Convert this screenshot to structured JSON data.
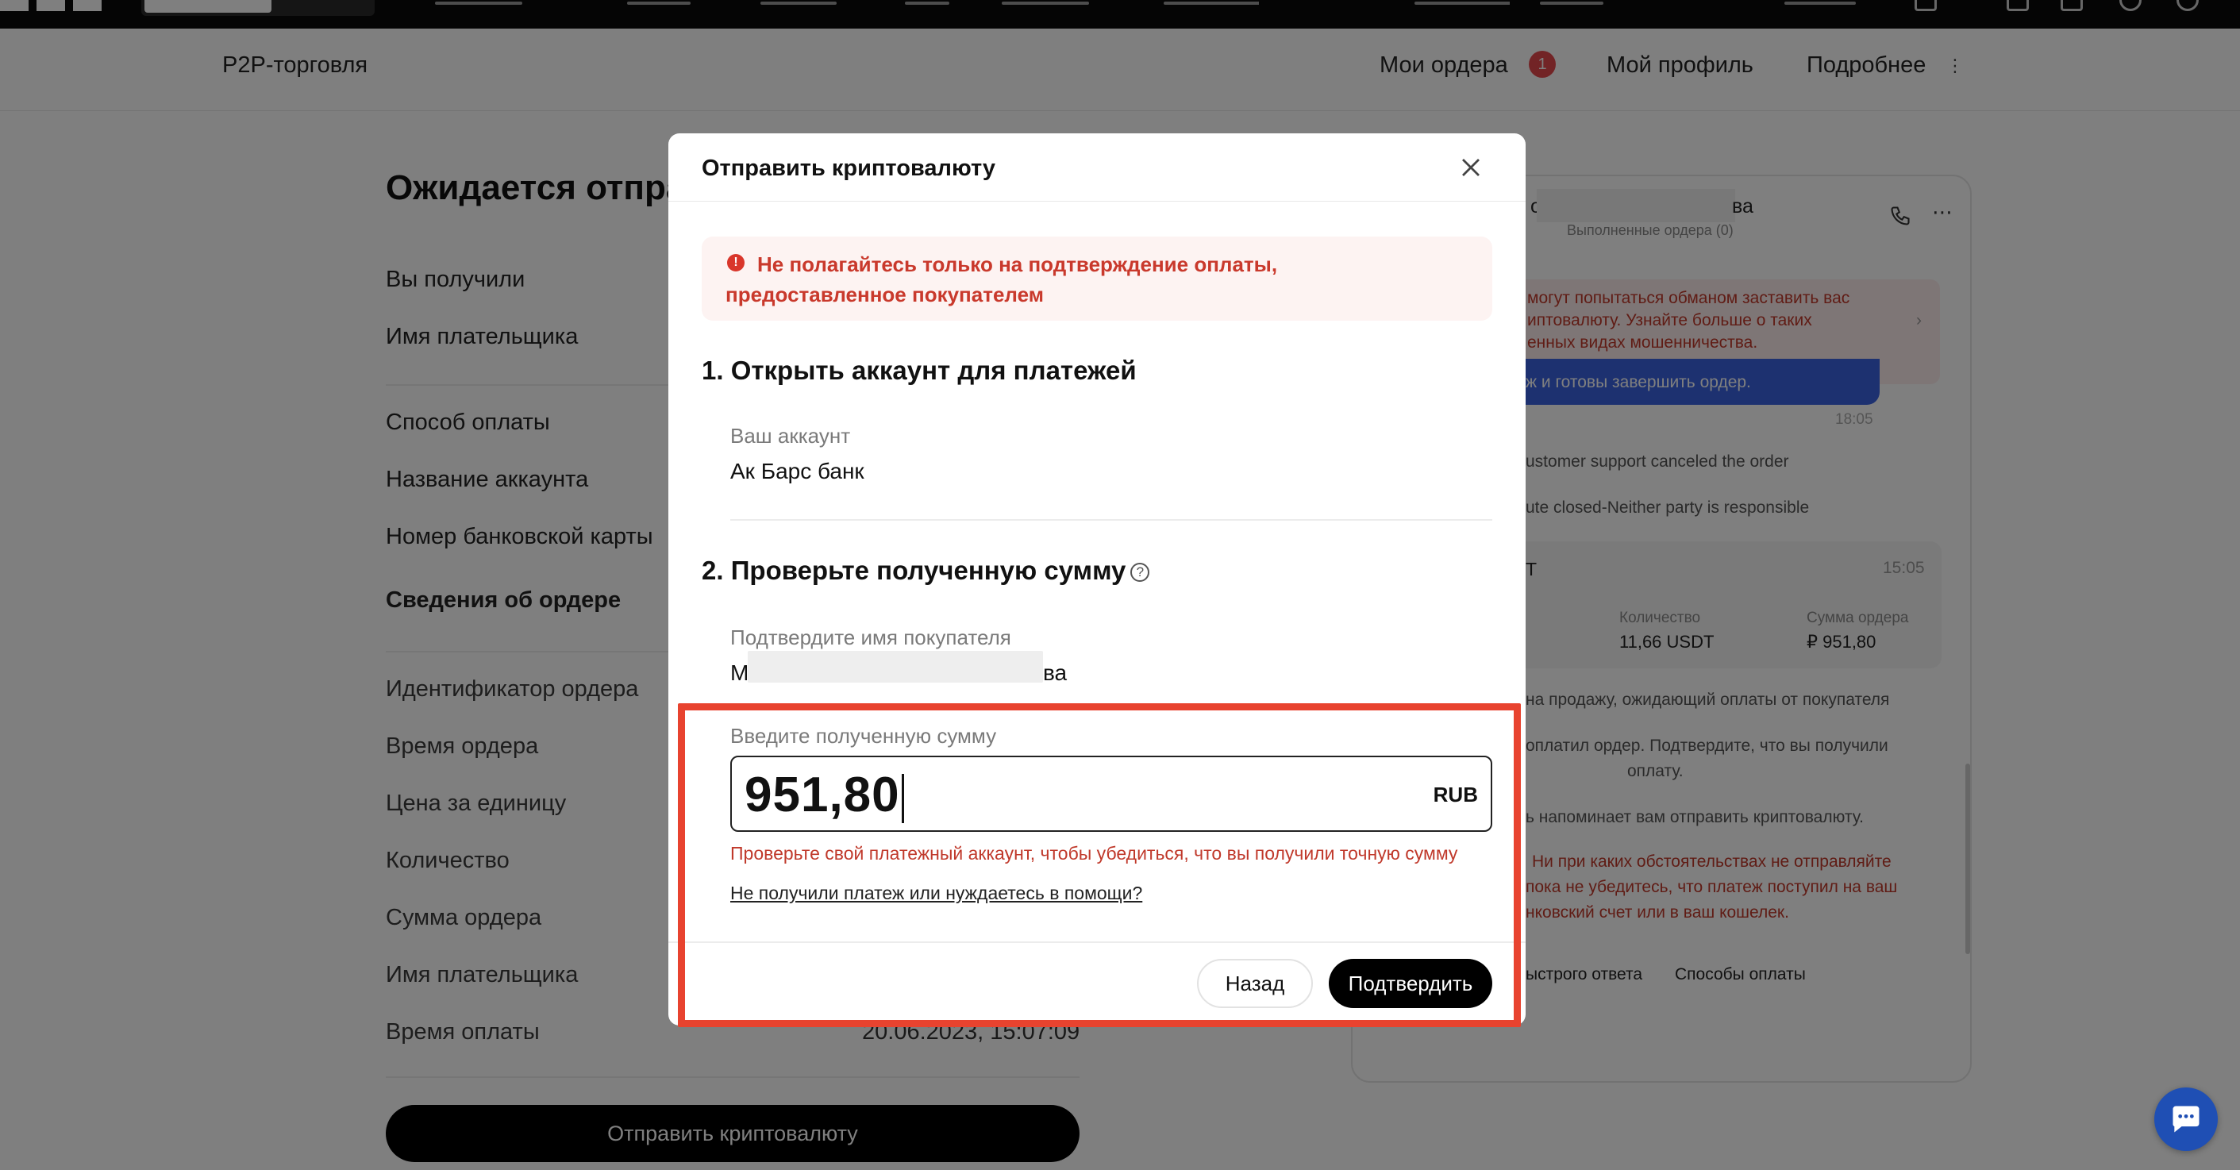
{
  "subheader": {
    "brand": "P2P-торговля",
    "my_orders": "Мои ордера",
    "orders_badge": "1",
    "my_profile": "Мой профиль",
    "more": "Подробнее",
    "more_dots": "⋮"
  },
  "left": {
    "title": "Ожидается отпра",
    "received": "Вы получили",
    "payer_name": "Имя плательщика",
    "payment_method": "Способ оплаты",
    "account_name": "Название аккаунта",
    "card_number": "Номер банковской карты",
    "order_details": "Сведения об ордере",
    "order_id": "Идентификатор ордера",
    "order_time": "Время ордера",
    "unit_price": "Цена за единицу",
    "quantity": "Количество",
    "order_sum": "Сумма ордера",
    "payer_name2": "Имя плательщика",
    "pay_time": "Время оплаты",
    "pay_time_value": "20.06.2023, 15:07:09",
    "send_button": "Отправить криптовалюту"
  },
  "chat": {
    "name_suffix": "ва",
    "name_prefix": "о",
    "orders_done": "Выполненные ордера (0)",
    "alert_line1": "могут попытаться обманом заставить вас",
    "alert_line2": "иптовалюту. Узнайте больше о таких",
    "alert_line3": "енных видах мошенничества.",
    "blue_line": "ж и готовы завершить ордер.",
    "time1": "18:05",
    "sys1": "ustomer support canceled the order",
    "sys2": "ute closed-Neither party is responsible",
    "card_title": "Т",
    "card_time": "15:05",
    "qty_label": "Количество",
    "qty_value": "11,66 USDT",
    "sum_label": "Сумма ордера",
    "sum_value": "₽ 951,80",
    "sys3": "на продажу, ожидающий оплаты от покупателя",
    "sys4a": "оплатил ордер. Подтвердите, что вы получили",
    "sys4b": "оплату.",
    "sys5": "ь напоминает вам отправить криптовалюту.",
    "warn_a": "Ни при каких обстоятельствах не отправляйте",
    "warn_b": "пока не убедитесь, что платеж поступил на ваш",
    "warn_c": "нковский счет или в ваш кошелек.",
    "quick_reply": "ыстрого ответа",
    "pay_methods": "Способы оплаты"
  },
  "modal": {
    "title": "Отправить криптовалюту",
    "warning": "Не полагайтесь только на подтверждение оплаты, предоставленное покупателем",
    "step1": "1. Открыть аккаунт для платежей",
    "account_label": "Ваш аккаунт",
    "account_value": "Ак Барс банк",
    "step2": "2. Проверьте полученную сумму",
    "buyer_label": "Подтвердите имя покупателя",
    "buyer_first": "М",
    "buyer_last": "ва",
    "amount_label": "Введите полученную сумму",
    "amount_value": "951,80",
    "currency": "RUB",
    "hint": "Проверьте свой платежный аккаунт, чтобы убедиться, что вы получили точную сумму",
    "help_link": "Не получили платеж или нуждаетесь в помощи?",
    "back_button": "Назад",
    "confirm_button": "Подтвердить"
  },
  "colors": {
    "accent_red": "#e8432f",
    "warning_text": "#c9392c",
    "primary_button": "#000000",
    "help_fab": "#1f4fb4"
  }
}
